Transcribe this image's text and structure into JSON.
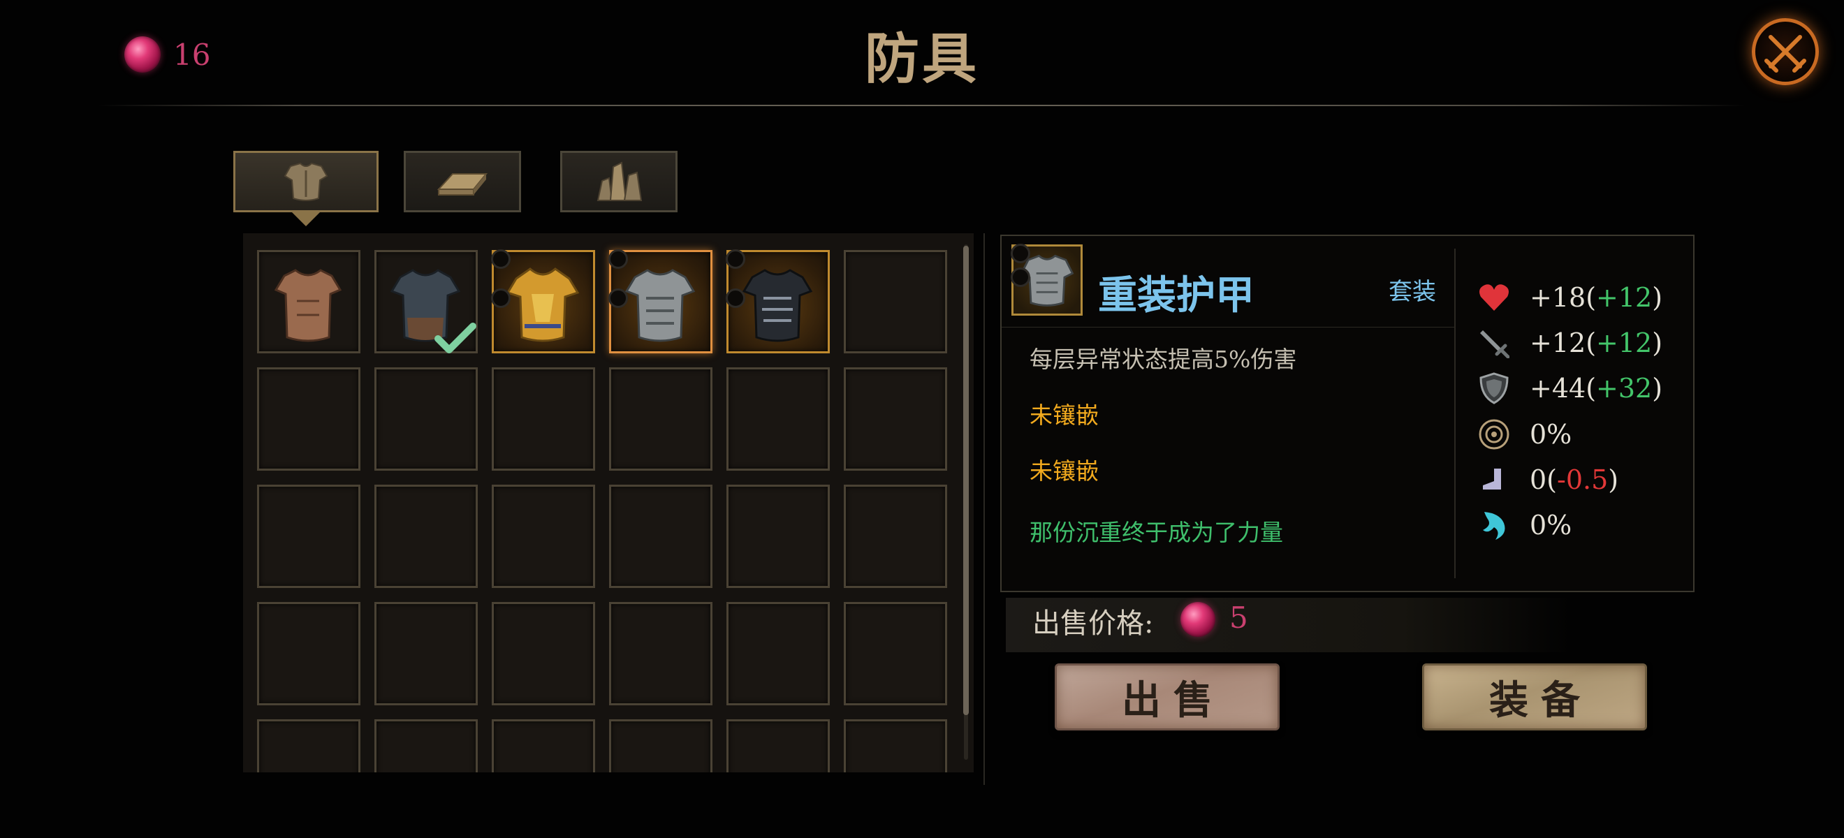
{
  "header": {
    "currency_value": "16",
    "title": "防具"
  },
  "tabs": [
    {
      "icon": "armor-icon",
      "active": true
    },
    {
      "icon": "ingot-icon",
      "active": false
    },
    {
      "icon": "crystal-icon",
      "active": false
    }
  ],
  "inventory": {
    "columns": 6,
    "slots": [
      {
        "item": "leather-armor",
        "equipped": false,
        "rare": false
      },
      {
        "item": "dark-plate-armor",
        "equipped": true,
        "rare": false
      },
      {
        "item": "golden-armor",
        "equipped": false,
        "rare": true
      },
      {
        "item": "heavy-armor",
        "equipped": false,
        "rare": true,
        "selected": true
      },
      {
        "item": "spiked-black-armor",
        "equipped": false,
        "rare": true
      }
    ]
  },
  "detail": {
    "name": "重装护甲",
    "set_tag": "套装",
    "effect": "每层异常状态提高5%伤害",
    "gem_slot_1": "未镶嵌",
    "gem_slot_2": "未镶嵌",
    "flavor": "那份沉重终于成为了力量",
    "stats": {
      "health": {
        "base": "+18(",
        "bonus": "+12",
        "end": ")"
      },
      "attack": {
        "base": "+12(",
        "bonus": "+12",
        "end": ")"
      },
      "defense": {
        "base": "+44(",
        "bonus": "+32",
        "end": ")"
      },
      "crit": {
        "value": "0%"
      },
      "speed": {
        "base": "0(",
        "bonus": "-0.5",
        "end": ")"
      },
      "skill": {
        "value": "0%"
      }
    }
  },
  "sell": {
    "label": "出售价格:",
    "value": "5"
  },
  "buttons": {
    "sell": "出售",
    "equip": "装备"
  },
  "colors": {
    "title": "#bfa57e",
    "currency": "#c9406f",
    "item_name": "#7cc4ec",
    "gem_text": "#f2aa1e",
    "flavor": "#3fbf6c",
    "bonus_positive": "#43c56a",
    "bonus_negative": "#e23838"
  }
}
